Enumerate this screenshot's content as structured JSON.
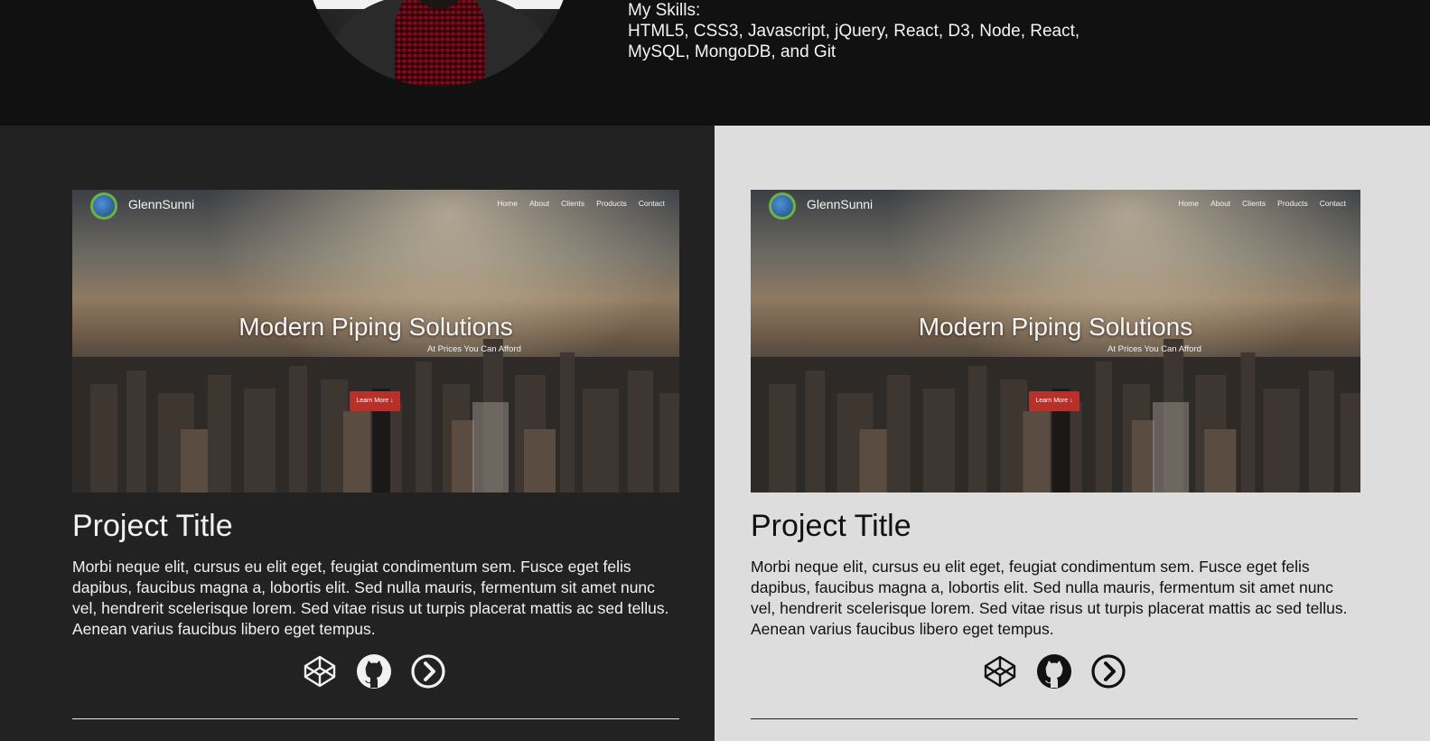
{
  "header": {
    "skills_heading": "My Skills:",
    "skills_list": "HTML5, CSS3, Javascript, jQuery, React, D3, Node, React, MySQL, MongoDB, and Git"
  },
  "projects": [
    {
      "theme": "dark",
      "title": "Project Title",
      "description": "Morbi neque elit, cursus eu elit eget, feugiat condimentum sem. Fusce eget felis dapibus, faucibus magna a, lobortis elit. Sed nulla mauris, fermentum sit amet nunc vel, hendrerit scelerisque lorem. Sed vitae risus ut turpis placerat mattis ac sed tellus. Aenean varius faucibus libero eget tempus.",
      "screenshot": {
        "brand": "GlennSunni",
        "nav": [
          "Home",
          "About",
          "Clients",
          "Products",
          "Contact"
        ],
        "hero_title": "Modern Piping Solutions",
        "hero_subtitle": "At Prices You Can Afford",
        "cta_label": "Learn More ↓"
      },
      "links": [
        "codepen-icon",
        "github-icon",
        "arrow-right-circle-icon"
      ]
    },
    {
      "theme": "light",
      "title": "Project Title",
      "description": "Morbi neque elit, cursus eu elit eget, feugiat condimentum sem. Fusce eget felis dapibus, faucibus magna a, lobortis elit. Sed nulla mauris, fermentum sit amet nunc vel, hendrerit scelerisque lorem. Sed vitae risus ut turpis placerat mattis ac sed tellus. Aenean varius faucibus libero eget tempus.",
      "screenshot": {
        "brand": "GlennSunni",
        "nav": [
          "Home",
          "About",
          "Clients",
          "Products",
          "Contact"
        ],
        "hero_title": "Modern Piping Solutions",
        "hero_subtitle": "At Prices You Can Afford",
        "cta_label": "Learn More ↓"
      },
      "links": [
        "codepen-icon",
        "github-icon",
        "arrow-right-circle-icon"
      ]
    }
  ],
  "colors": {
    "header_bg": "#111111",
    "dark_panel_bg": "#222222",
    "light_panel_bg": "#dddddd",
    "cta_red": "#b8302a"
  }
}
